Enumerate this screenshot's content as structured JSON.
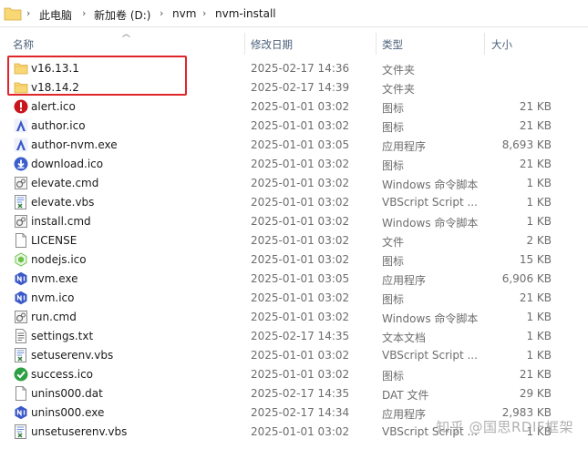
{
  "breadcrumb": [
    {
      "label": "此电脑"
    },
    {
      "label": "新加卷 (D:)"
    },
    {
      "label": "nvm"
    },
    {
      "label": "nvm-install"
    }
  ],
  "columns": {
    "name": "名称",
    "date": "修改日期",
    "type": "类型",
    "size": "大小"
  },
  "files": [
    {
      "name": "v16.13.1",
      "date": "2025-02-17 14:36",
      "type": "文件夹",
      "size": "",
      "icon": "folder-icon"
    },
    {
      "name": "v18.14.2",
      "date": "2025-02-17 14:39",
      "type": "文件夹",
      "size": "",
      "icon": "folder-icon"
    },
    {
      "name": "alert.ico",
      "date": "2025-01-01 03:02",
      "type": "图标",
      "size": "21 KB",
      "icon": "alert-icon"
    },
    {
      "name": "author.ico",
      "date": "2025-01-01 03:02",
      "type": "图标",
      "size": "21 KB",
      "icon": "author-icon"
    },
    {
      "name": "author-nvm.exe",
      "date": "2025-01-01 03:05",
      "type": "应用程序",
      "size": "8,693 KB",
      "icon": "author-icon"
    },
    {
      "name": "download.ico",
      "date": "2025-01-01 03:02",
      "type": "图标",
      "size": "21 KB",
      "icon": "download-icon"
    },
    {
      "name": "elevate.cmd",
      "date": "2025-01-01 03:02",
      "type": "Windows 命令脚本",
      "size": "1 KB",
      "icon": "cmd-script-icon"
    },
    {
      "name": "elevate.vbs",
      "date": "2025-01-01 03:02",
      "type": "VBScript Script ...",
      "size": "1 KB",
      "icon": "vbs-script-icon"
    },
    {
      "name": "install.cmd",
      "date": "2025-01-01 03:02",
      "type": "Windows 命令脚本",
      "size": "1 KB",
      "icon": "cmd-script-icon"
    },
    {
      "name": "LICENSE",
      "date": "2025-01-01 03:02",
      "type": "文件",
      "size": "2 KB",
      "icon": "file-icon"
    },
    {
      "name": "nodejs.ico",
      "date": "2025-01-01 03:02",
      "type": "图标",
      "size": "15 KB",
      "icon": "nodejs-icon"
    },
    {
      "name": "nvm.exe",
      "date": "2025-01-01 03:05",
      "type": "应用程序",
      "size": "6,906 KB",
      "icon": "nvm-icon"
    },
    {
      "name": "nvm.ico",
      "date": "2025-01-01 03:02",
      "type": "图标",
      "size": "21 KB",
      "icon": "nvm-icon"
    },
    {
      "name": "run.cmd",
      "date": "2025-01-01 03:02",
      "type": "Windows 命令脚本",
      "size": "1 KB",
      "icon": "cmd-script-icon"
    },
    {
      "name": "settings.txt",
      "date": "2025-02-17 14:35",
      "type": "文本文档",
      "size": "1 KB",
      "icon": "text-file-icon"
    },
    {
      "name": "setuserenv.vbs",
      "date": "2025-01-01 03:02",
      "type": "VBScript Script ...",
      "size": "1 KB",
      "icon": "vbs-script-icon"
    },
    {
      "name": "success.ico",
      "date": "2025-01-01 03:02",
      "type": "图标",
      "size": "21 KB",
      "icon": "success-icon"
    },
    {
      "name": "unins000.dat",
      "date": "2025-02-17 14:35",
      "type": "DAT 文件",
      "size": "29 KB",
      "icon": "file-icon"
    },
    {
      "name": "unins000.exe",
      "date": "2025-02-17 14:34",
      "type": "应用程序",
      "size": "2,983 KB",
      "icon": "nvm-icon"
    },
    {
      "name": "unsetuserenv.vbs",
      "date": "2025-01-01 03:02",
      "type": "VBScript Script ...",
      "size": "1 KB",
      "icon": "vbs-script-icon"
    }
  ],
  "watermark": "知乎 @国思RDIF框架",
  "colors": {
    "highlight": "#e0262a",
    "folder": "#f8d775",
    "header_text": "#4c607a"
  }
}
